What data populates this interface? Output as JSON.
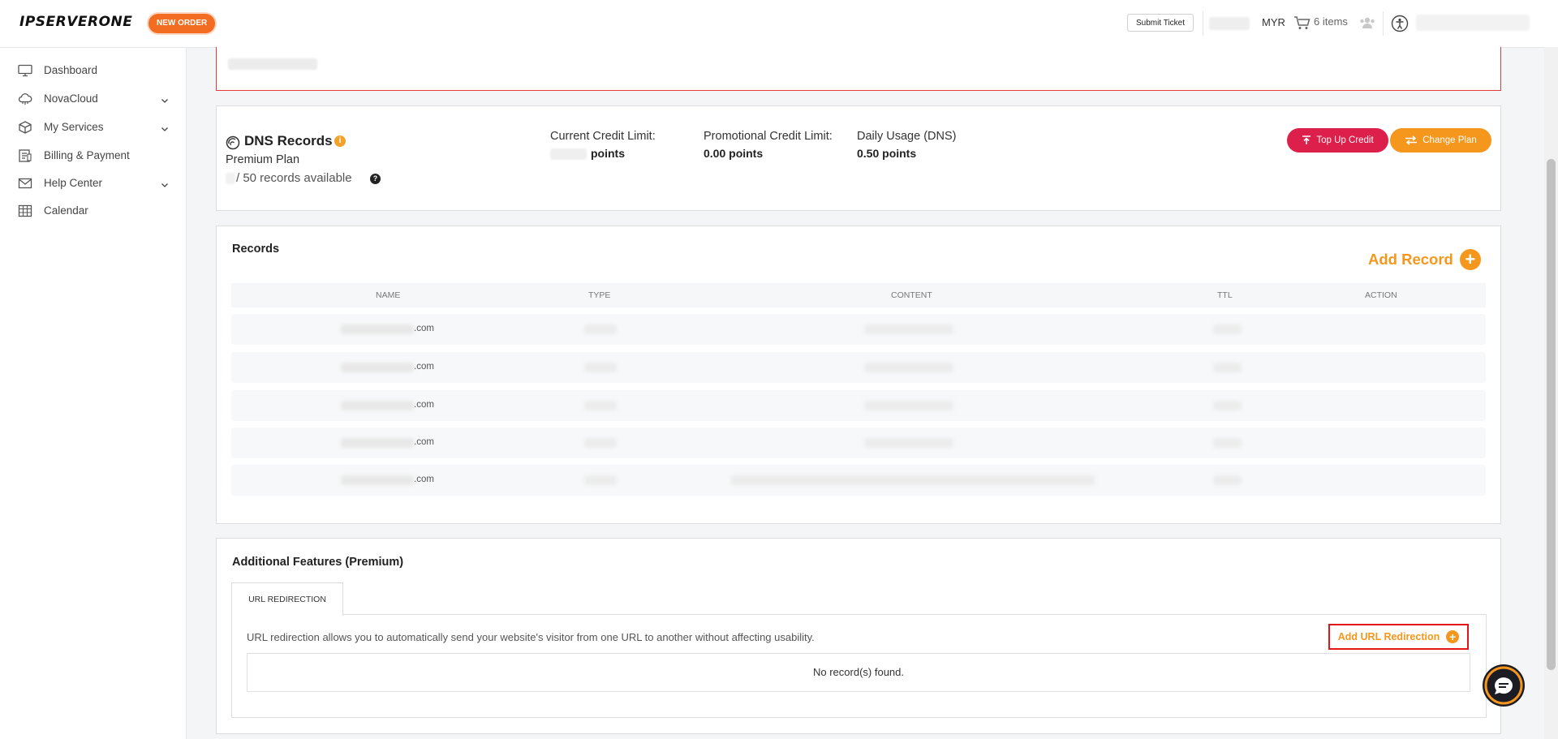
{
  "header": {
    "logo": "IPSERVERONE",
    "new_order": "NEW ORDER",
    "submit_ticket": "Submit Ticket",
    "currency": "MYR",
    "cart_label": "6 items"
  },
  "sidebar": {
    "items": [
      {
        "label": "Dashboard"
      },
      {
        "label": "NovaCloud"
      },
      {
        "label": "My Services"
      },
      {
        "label": "Billing & Payment"
      },
      {
        "label": "Help Center"
      },
      {
        "label": "Calendar"
      }
    ]
  },
  "dns": {
    "title": "DNS Records",
    "plan": "Premium Plan",
    "records_available": "/ 50 records available",
    "current_credit_label": "Current Credit Limit:",
    "current_credit_unit": "points",
    "promo_label": "Promotional Credit Limit:",
    "promo_value": "0.00 points",
    "daily_label": "Daily Usage (DNS)",
    "daily_value": "0.50 points",
    "top_up": "Top Up Credit",
    "change_plan": "Change Plan"
  },
  "records": {
    "heading": "Records",
    "add_record": "Add Record",
    "columns": [
      "NAME",
      "TYPE",
      "CONTENT",
      "TTL",
      "ACTION"
    ],
    "rows": [
      {
        "name_suffix": ".com"
      },
      {
        "name_suffix": ".com"
      },
      {
        "name_suffix": ".com"
      },
      {
        "name_suffix": ".com"
      },
      {
        "name_suffix": ".com"
      }
    ]
  },
  "features": {
    "title": "Additional Features (Premium)",
    "tab": "URL REDIRECTION",
    "description": "URL redirection allows you to automatically send your website's visitor from one URL to another without affecting usability.",
    "add_url": "Add URL Redirection",
    "empty": "No record(s) found."
  },
  "colors": {
    "accent_orange": "#f5961d",
    "top_up_red": "#dc1f4b",
    "highlight_red": "#e3151a"
  }
}
